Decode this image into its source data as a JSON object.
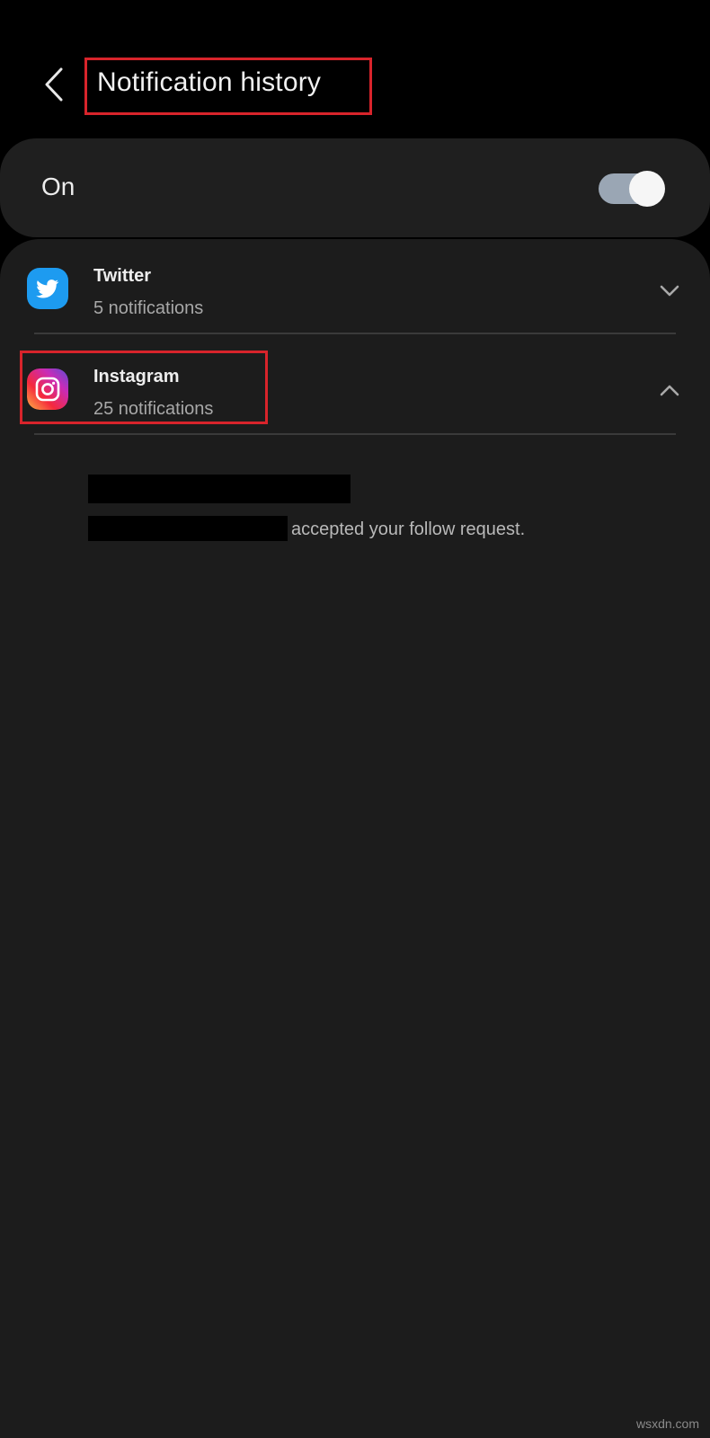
{
  "header": {
    "title": "Notification history"
  },
  "toggle": {
    "label": "On",
    "state": "on",
    "track_color": "#9aa6b4"
  },
  "apps": [
    {
      "name": "Twitter",
      "count": "5 notifications",
      "icon": "twitter-bird-icon",
      "expanded": false,
      "brand_color": "#1d9bf0"
    },
    {
      "name": "Instagram",
      "count": "25 notifications",
      "icon": "instagram-camera-icon",
      "expanded": true
    }
  ],
  "notification": {
    "text": "accepted your follow request."
  },
  "annotation_color": "#d8242b",
  "watermark": "wsxdn.com"
}
